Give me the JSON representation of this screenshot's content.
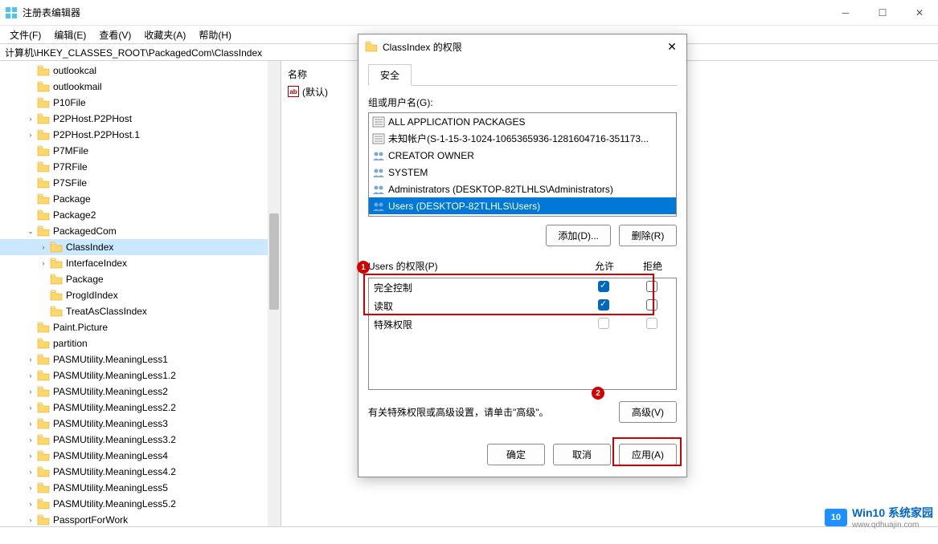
{
  "titlebar": {
    "text": "注册表编辑器"
  },
  "menu": [
    "文件(F)",
    "编辑(E)",
    "查看(V)",
    "收藏夹(A)",
    "帮助(H)"
  ],
  "address": "计算机\\HKEY_CLASSES_ROOT\\PackagedCom\\ClassIndex",
  "values_header": "名称",
  "value_default": "(默认)",
  "tree": [
    {
      "indent": 2,
      "expander": "",
      "label": "outlookcal"
    },
    {
      "indent": 2,
      "expander": "",
      "label": "outlookmail"
    },
    {
      "indent": 2,
      "expander": "",
      "label": "P10File"
    },
    {
      "indent": 2,
      "expander": ">",
      "label": "P2PHost.P2PHost"
    },
    {
      "indent": 2,
      "expander": ">",
      "label": "P2PHost.P2PHost.1"
    },
    {
      "indent": 2,
      "expander": "",
      "label": "P7MFile"
    },
    {
      "indent": 2,
      "expander": "",
      "label": "P7RFile"
    },
    {
      "indent": 2,
      "expander": "",
      "label": "P7SFile"
    },
    {
      "indent": 2,
      "expander": "",
      "label": "Package"
    },
    {
      "indent": 2,
      "expander": "",
      "label": "Package2"
    },
    {
      "indent": 2,
      "expander": "v",
      "label": "PackagedCom"
    },
    {
      "indent": 3,
      "expander": ">",
      "label": "ClassIndex",
      "selected": true
    },
    {
      "indent": 3,
      "expander": ">",
      "label": "InterfaceIndex"
    },
    {
      "indent": 3,
      "expander": "",
      "label": "Package"
    },
    {
      "indent": 3,
      "expander": "",
      "label": "ProgIdIndex"
    },
    {
      "indent": 3,
      "expander": "",
      "label": "TreatAsClassIndex"
    },
    {
      "indent": 2,
      "expander": "",
      "label": "Paint.Picture"
    },
    {
      "indent": 2,
      "expander": "",
      "label": "partition"
    },
    {
      "indent": 2,
      "expander": ">",
      "label": "PASMUtility.MeaningLess1"
    },
    {
      "indent": 2,
      "expander": ">",
      "label": "PASMUtility.MeaningLess1.2"
    },
    {
      "indent": 2,
      "expander": ">",
      "label": "PASMUtility.MeaningLess2"
    },
    {
      "indent": 2,
      "expander": ">",
      "label": "PASMUtility.MeaningLess2.2"
    },
    {
      "indent": 2,
      "expander": ">",
      "label": "PASMUtility.MeaningLess3"
    },
    {
      "indent": 2,
      "expander": ">",
      "label": "PASMUtility.MeaningLess3.2"
    },
    {
      "indent": 2,
      "expander": ">",
      "label": "PASMUtility.MeaningLess4"
    },
    {
      "indent": 2,
      "expander": ">",
      "label": "PASMUtility.MeaningLess4.2"
    },
    {
      "indent": 2,
      "expander": ">",
      "label": "PASMUtility.MeaningLess5"
    },
    {
      "indent": 2,
      "expander": ">",
      "label": "PASMUtility.MeaningLess5.2"
    },
    {
      "indent": 2,
      "expander": ">",
      "label": "PassportForWork"
    }
  ],
  "dialog": {
    "title": "ClassIndex 的权限",
    "tab": "安全",
    "group_label": "组或用户名(G):",
    "groups": [
      "ALL APPLICATION PACKAGES",
      "未知帐户(S-1-15-3-1024-1065365936-1281604716-351173...",
      "CREATOR OWNER",
      "SYSTEM",
      "Administrators (DESKTOP-82TLHLS\\Administrators)",
      "Users (DESKTOP-82TLHLS\\Users)"
    ],
    "add_btn": "添加(D)...",
    "remove_btn": "删除(R)",
    "perm_label": "Users 的权限(P)",
    "allow": "允许",
    "deny": "拒绝",
    "perms": [
      {
        "name": "完全控制",
        "allow": true,
        "deny": false
      },
      {
        "name": "读取",
        "allow": true,
        "deny": false
      },
      {
        "name": "特殊权限",
        "allow": false,
        "deny": false,
        "dim": true
      }
    ],
    "adv_text": "有关特殊权限或高级设置，请单击\"高级\"。",
    "adv_btn": "高级(V)",
    "ok": "确定",
    "cancel": "取消",
    "apply": "应用(A)"
  },
  "watermark": {
    "brand": "Win10 系统家园",
    "url": "www.qdhuajin.com",
    "icon_text": "10"
  }
}
